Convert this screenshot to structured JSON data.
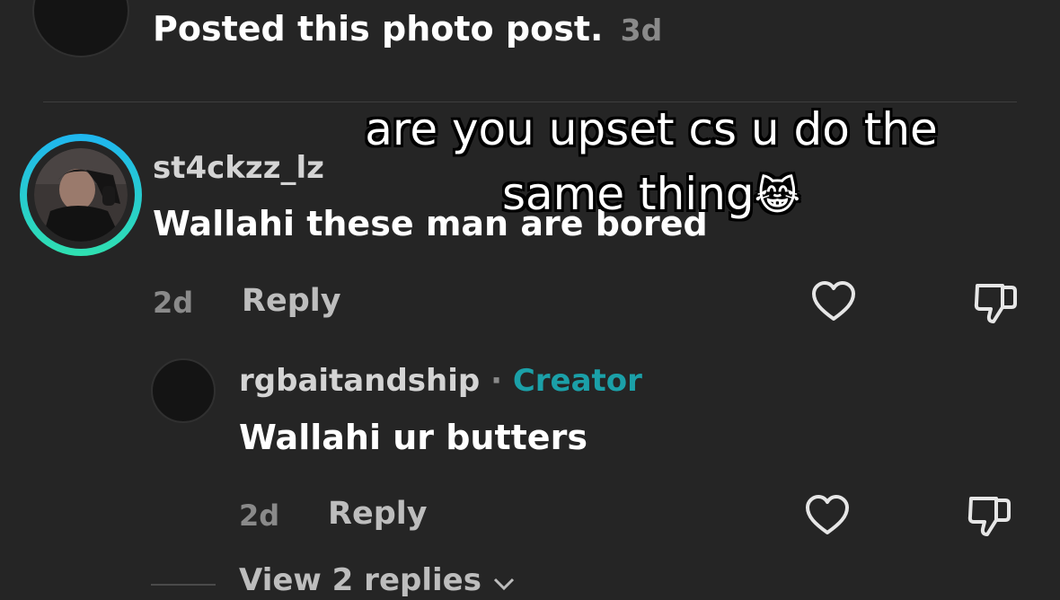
{
  "top_post": {
    "text": "Posted this photo post.",
    "time": "3d"
  },
  "comment": {
    "username": "st4ckzz_lz",
    "text": "Wallahi these man are bored",
    "time": "2d",
    "reply_label": "Reply"
  },
  "reply_comment": {
    "username": "rgbaitandship",
    "separator": "·",
    "badge": "Creator",
    "text": "Wallahi ur butters",
    "time": "2d",
    "reply_label": "Reply"
  },
  "view_replies": {
    "label": "View 2 replies"
  },
  "overlay_caption": {
    "line1": "are you upset cs u do the",
    "line2": "same thing",
    "emoji": "😹"
  },
  "colors": {
    "background": "#252525",
    "creator_badge": "#1ba0a8",
    "story_ring_start": "#1fb6f0",
    "story_ring_end": "#2fe0b0"
  },
  "icons": [
    "heart-icon",
    "dislike-icon",
    "chevron-down-icon"
  ]
}
